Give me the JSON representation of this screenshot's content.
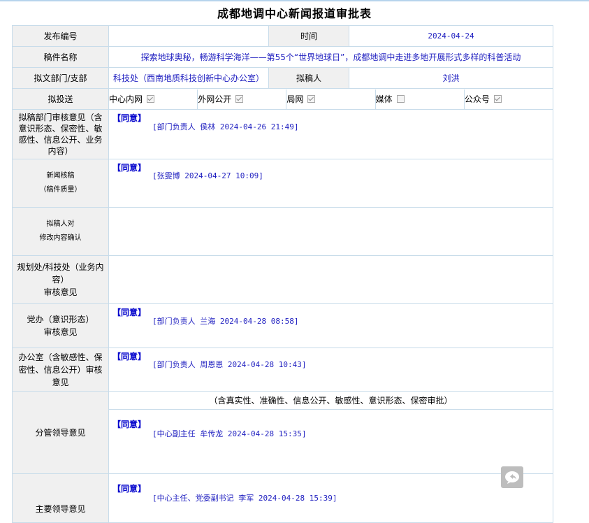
{
  "title": "成都地调中心新闻报道审批表",
  "form": {
    "release_no_label": "发布编号",
    "release_no_value": "",
    "time_label": "时间",
    "time_value": "2024-04-24",
    "manuscript_label": "稿件名称",
    "manuscript_value": "探索地球奥秘，畅游科学海洋——第55个“世界地球日”，成都地调中走进多地开展形式多样的科普活动",
    "dept_label": "拟文部门/支部",
    "dept_value": "科技处（西南地质科技创新中心办公室）",
    "drafter_label": "拟稿人",
    "drafter_value": "刘洪",
    "channel_label": "拟投送",
    "channels": [
      {
        "label": "中心内网",
        "checked": true
      },
      {
        "label": "外网公开",
        "checked": true
      },
      {
        "label": "局网",
        "checked": true
      },
      {
        "label": "媒体",
        "checked": false
      },
      {
        "label": "公众号",
        "checked": true
      }
    ]
  },
  "opinions": [
    {
      "label": "拟稿部门审核意见（含意识形态、保密性、敏感性、信息公开、业务内容）",
      "agree": "【同意】",
      "sign": "[部门负责人 侯林 2024-04-26 21:49]"
    },
    {
      "label_line1": "新闻核稿",
      "label_line2": "（稿件质量）",
      "agree": "【同意】",
      "sign": "[张雯博 2024-04-27 10:09]"
    },
    {
      "label_line1": "拟稿人对",
      "label_line2": "修改内容确认"
    },
    {
      "label_line1": "规划处/科技处（业务内容）",
      "label_line2": "审核意见"
    },
    {
      "label_line1": "党办（意识形态）",
      "label_line2": "审核意见",
      "agree": "【同意】",
      "sign": "[部门负责人 兰海 2024-04-28 08:58]"
    },
    {
      "label": "办公室（含敏感性、保密性、信息公开）审核意见",
      "agree": "【同意】",
      "sign": "[部门负责人 周恩恩 2024-04-28 10:43]"
    },
    {
      "label": "分管领导意见",
      "note": "（含真实性、准确性、信息公开、敏感性、意识形态、保密审批）",
      "agree": "【同意】",
      "sign": "[中心副主任 牟传龙 2024-04-28 15:35]"
    },
    {
      "label": "主要领导意见",
      "agree": "【同意】",
      "sign": "[中心主任、党委副书记 李军 2024-04-28 15:39]"
    }
  ],
  "icons": {
    "float_button": "reply-chat-icon"
  }
}
